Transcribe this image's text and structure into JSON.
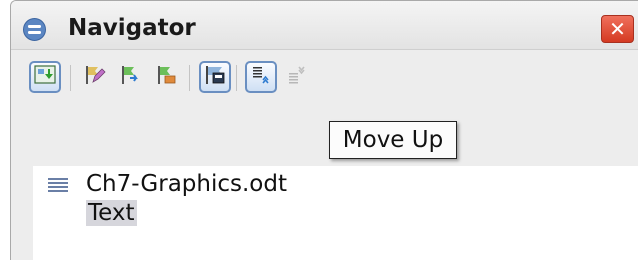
{
  "window": {
    "title": "Navigator",
    "close_symbol": "✕"
  },
  "toolbar": {
    "buttons": [
      {
        "name": "navigation-toggle",
        "icon": "navigation-icon",
        "pressed": true
      },
      {
        "name": "edit",
        "icon": "pencil-icon",
        "pressed": false
      },
      {
        "name": "promote",
        "icon": "flag-green-icon",
        "pressed": false
      },
      {
        "name": "demote",
        "icon": "flag-demote-icon",
        "pressed": false
      },
      {
        "name": "content-view",
        "icon": "content-view-icon",
        "pressed": true
      },
      {
        "name": "move-up",
        "icon": "move-up-icon",
        "pressed": true
      },
      {
        "name": "move-down",
        "icon": "move-down-icon",
        "pressed": false,
        "disabled": true
      }
    ]
  },
  "tooltip": {
    "text": "Move Up"
  },
  "tree": {
    "document": "Ch7-Graphics.odt",
    "items": [
      "Text"
    ]
  },
  "colors": {
    "accent": "#6a8fc1",
    "close_button": "#d43a22",
    "selection": "#d6d6dc"
  }
}
